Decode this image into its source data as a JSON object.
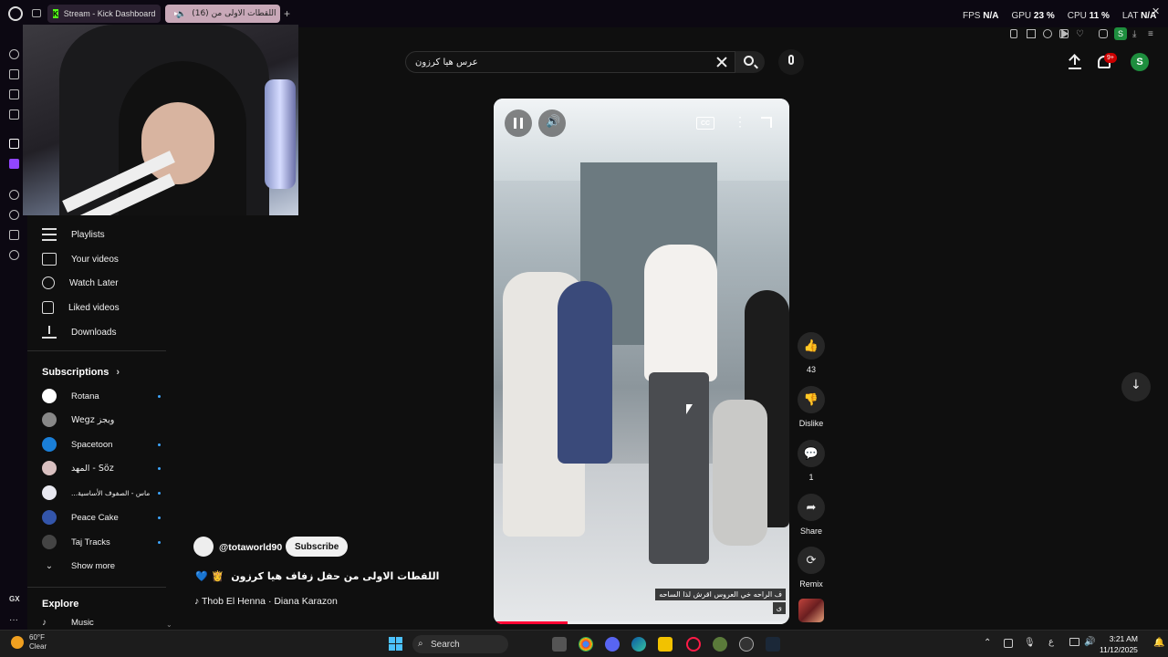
{
  "browser": {
    "tabs": [
      {
        "label": "Stream - Kick Dashboard"
      },
      {
        "label": "(16) اللقطات الاولى من"
      }
    ],
    "hud": {
      "fps_label": "FPS",
      "fps_value": "N/A",
      "gpu_label": "GPU",
      "gpu_value": "23 %",
      "cpu_label": "CPU",
      "cpu_value": "11 %",
      "lat_label": "LAT",
      "lat_value": "N/A"
    },
    "gx_label": "GX"
  },
  "search": {
    "value": "عرس هيا كرزون"
  },
  "header": {
    "notif_count": "9+",
    "account_initial": "S"
  },
  "sidebar": {
    "items": [
      {
        "label": "Playlists",
        "icon": "playlist-icon"
      },
      {
        "label": "Your videos",
        "icon": "video-icon"
      },
      {
        "label": "Watch Later",
        "icon": "clock-icon"
      },
      {
        "label": "Liked videos",
        "icon": "thumbs-up-icon"
      },
      {
        "label": "Downloads",
        "icon": "download-icon"
      }
    ],
    "subscriptions_title": "Subscriptions",
    "subscriptions": [
      {
        "label": "Rotana",
        "color": "#ffffff",
        "dot": true
      },
      {
        "label": "Wegz ويجز",
        "color": "#888888",
        "dot": false
      },
      {
        "label": "Spacetoon",
        "color": "#1a7fd8",
        "dot": true
      },
      {
        "label": "المهد - Söz",
        "color": "#d9c0c0",
        "dot": true
      },
      {
        "label": "...ماس - الصفوف الأساسية",
        "color": "#e8e8f0",
        "dot": true
      },
      {
        "label": "Peace Cake",
        "color": "#3355aa",
        "dot": true
      },
      {
        "label": "Taj Tracks",
        "color": "#444444",
        "dot": true
      }
    ],
    "show_more": "Show more",
    "explore_title": "Explore",
    "explore_items": [
      {
        "label": "Music"
      }
    ]
  },
  "video": {
    "cc_label": "CC",
    "progress": 0.25,
    "caption_line1": "ف الراحه خي العروس اقرش لذا الساحه",
    "caption_line2": "ى"
  },
  "actions": {
    "like_count": "43",
    "dislike_label": "Dislike",
    "comment_count": "1",
    "share_label": "Share",
    "remix_label": "Remix"
  },
  "channel": {
    "handle": "@totaworld90",
    "subscribe_label": "Subscribe",
    "title_emojis": "💙 👸",
    "title": "اللقطات الاولى من حفل زفاف هيا كرزون",
    "music": "♪ Thob El Henna · Diana Karazon"
  },
  "taskbar": {
    "weather_temp": "60°F",
    "weather_desc": "Clear",
    "search_label": "Search",
    "time": "3:21 AM",
    "date": "11/12/2025",
    "lang": "ع"
  }
}
